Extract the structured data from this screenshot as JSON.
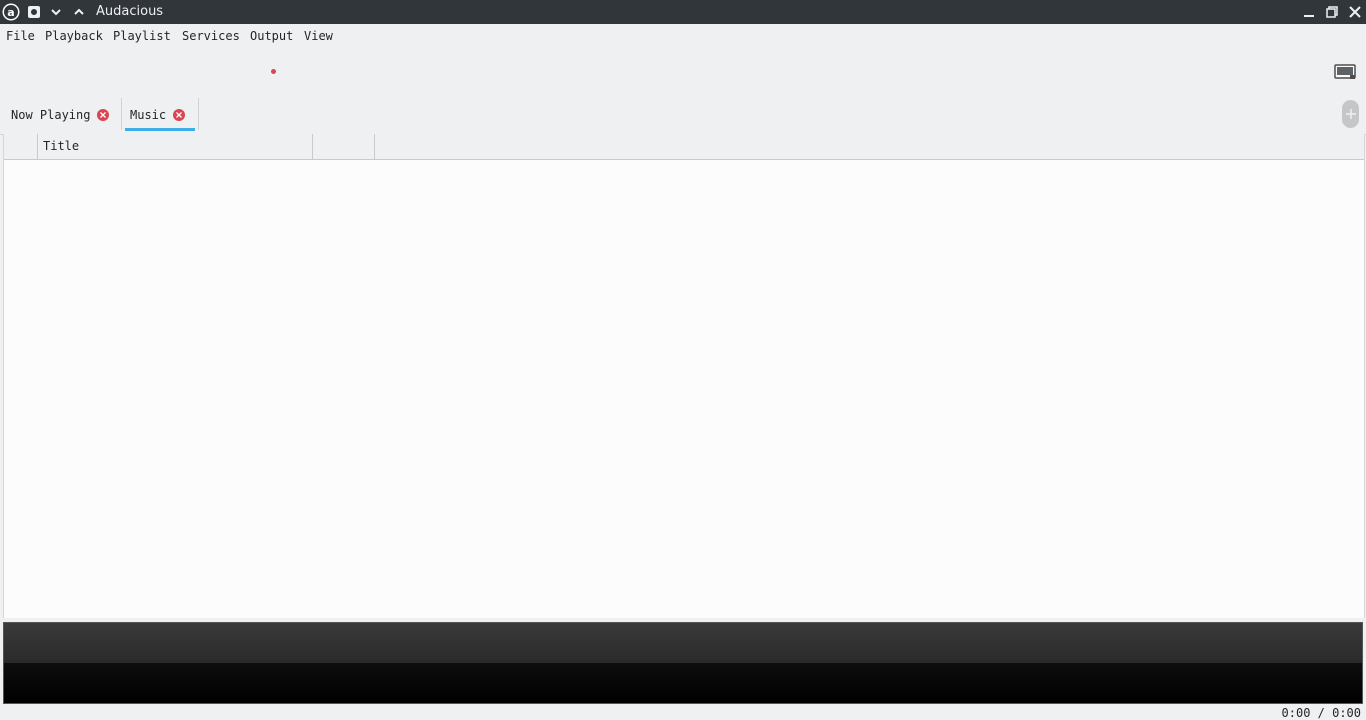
{
  "window": {
    "title": "Audacious"
  },
  "menubar": {
    "items": [
      "File",
      "Playback",
      "Playlist",
      "Services",
      "Output",
      "View"
    ]
  },
  "tabs": [
    {
      "label": "Now Playing",
      "active": false
    },
    {
      "label": "Music",
      "active": true
    }
  ],
  "playlist": {
    "columns": [
      "",
      "Title",
      "",
      ""
    ]
  },
  "status": {
    "time": "0:00 / 0:00"
  },
  "colors": {
    "titlebar": "#31363b",
    "accent": "#3daee9",
    "close_red": "#da4453",
    "record_dot": "#da4453"
  },
  "icons": {
    "app": "audacious-logo-icon",
    "window_buttons": [
      "pin-icon",
      "chevron-down-icon",
      "chevron-up-icon",
      "minimize-icon",
      "maximize-icon",
      "close-icon"
    ],
    "toolbar_right": "display-icon",
    "add_tab": "plus-icon"
  }
}
